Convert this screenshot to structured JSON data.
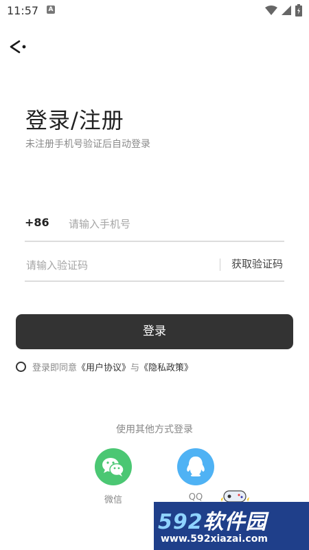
{
  "status_bar": {
    "time": "11:57",
    "notification_badge": "A"
  },
  "header": {
    "back_icon": "back-arrow-icon"
  },
  "title": {
    "main": "登录/注册",
    "subtitle": "未注册手机号验证后自动登录"
  },
  "phone": {
    "country_code": "+86",
    "placeholder": "请输入手机号",
    "value": ""
  },
  "verification": {
    "placeholder": "请输入验证码",
    "value": "",
    "get_code_label": "获取验证码"
  },
  "login_button": {
    "label": "登录"
  },
  "agreement": {
    "prefix": "登录即同意",
    "user_agreement": "《用户协议》",
    "connector": "与",
    "privacy_policy": "《隐私政策》",
    "checked": false
  },
  "other_login": {
    "title": "使用其他方式登录",
    "wechat_label": "微信",
    "qq_label": "QQ"
  },
  "watermark": {
    "brand_num": "592",
    "brand_text": "软件园",
    "url": "www.592xiazai.com"
  },
  "colors": {
    "button_bg": "#333333",
    "wechat": "#4bc773",
    "qq": "#4fb2f4",
    "divider": "#dcdcdc"
  }
}
